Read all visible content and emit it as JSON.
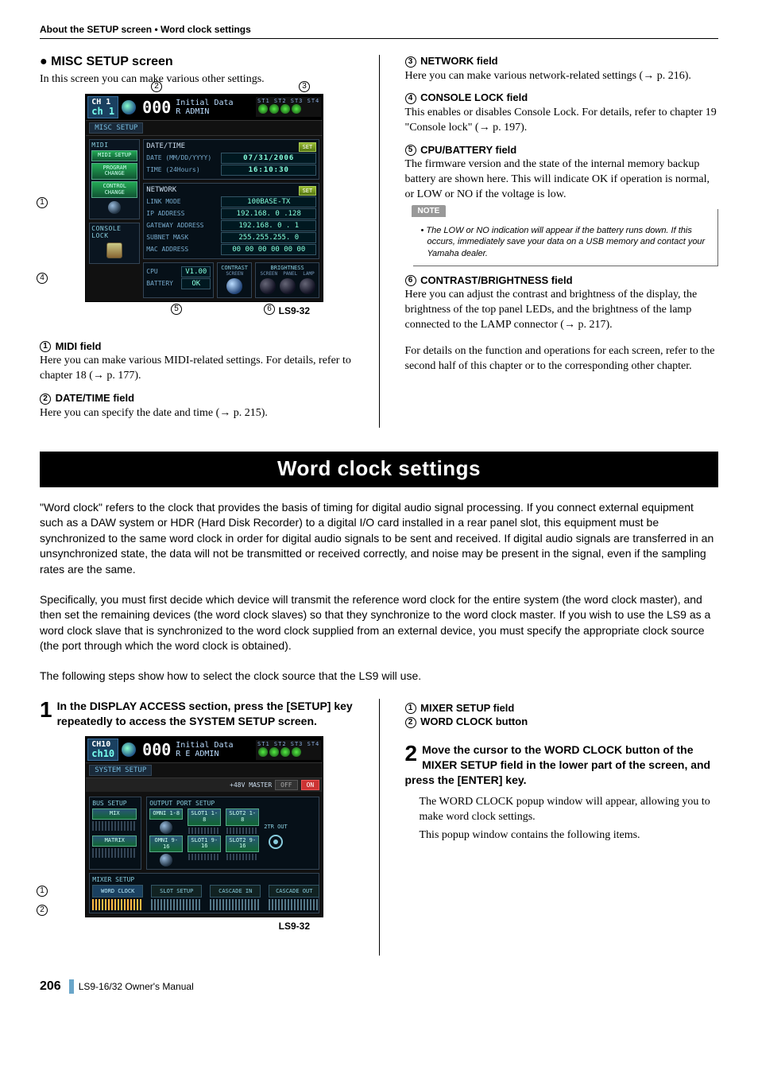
{
  "header": "About the SETUP screen • Word clock settings",
  "left": {
    "miscHeading": "MISC SETUP screen",
    "miscIntro": "In this screen you can make various other settings.",
    "fig1Caption": "LS9-32",
    "field1Title": "MIDI field",
    "field1Body": "Here you can make various MIDI-related settings. For details, refer to chapter 18 (→ p. 177).",
    "field2Title": "DATE/TIME field",
    "field2Body": "Here you can specify the date and time (→ p. 215)."
  },
  "right": {
    "field3Title": "NETWORK field",
    "field3Body": "Here you can make various network-related settings (→ p. 216).",
    "field4Title": "CONSOLE LOCK field",
    "field4Body": "This enables or disables Console Lock. For details, refer to chapter 19 \"Console lock\" (→ p. 197).",
    "field5Title": "CPU/BATTERY field",
    "field5Body": "The firmware version and the state of the internal memory backup battery are shown here. This will indicate OK if operation is normal, or LOW or NO if the voltage is low.",
    "noteLabel": "NOTE",
    "noteText": "• The LOW or NO indication will appear if the battery runs down. If this occurs, immediately save your data on a USB memory and contact your Yamaha dealer.",
    "field6Title": "CONTRAST/BRIGHTNESS field",
    "field6Body": "Here you can adjust the contrast and brightness of the display, the brightness of the top panel LEDs, and the brightness of the lamp connected to the LAMP connector (→ p. 217).",
    "closing": "For details on the function and operations for each screen, refer to the second half of this chapter or to the corresponding other chapter."
  },
  "section": {
    "banner": "Word clock settings",
    "introP1": "\"Word clock\" refers to the clock that provides the basis of timing for digital audio signal processing. If you connect external equipment such as a DAW system or HDR (Hard Disk Recorder) to a digital I/O card installed in a rear panel slot, this equipment must be synchronized to the same word clock in order for digital audio signals to be sent and received. If digital audio signals are transferred in an unsynchronized state, the data will not be transmitted or received correctly, and noise may be present in the signal, even if the sampling rates are the same.",
    "introP2": "Specifically, you must first decide which device will transmit the reference word clock for the entire system (the word clock master), and then set the remaining devices (the word clock slaves) so that they synchronize to the word clock master. If you wish to use the LS9 as a word clock slave that is synchronized to the word clock supplied from an external device, you must specify the appropriate clock source (the port through which the word clock is obtained).",
    "introP3": "The following steps show how to select the clock source that the LS9 will use."
  },
  "steps": {
    "s1num": "1",
    "s1head": "In the DISPLAY ACCESS section, press the [SETUP] key repeatedly to access the SYSTEM SETUP screen.",
    "fig2Caption": "LS9-32",
    "callLabel1": "MIXER SETUP field",
    "callLabel2": "WORD CLOCK button",
    "s2num": "2",
    "s2head": "Move the cursor to the WORD CLOCK button of the MIXER SETUP field in the lower part of the screen, and press the [ENTER] key.",
    "s2body1": "The WORD CLOCK popup window will appear, allowing you to make word clock settings.",
    "s2body2": "This popup window contains the following items."
  },
  "misc_screen": {
    "ch_label": "CH 1",
    "ch_name": "ch 1",
    "scene_num": "000",
    "scene_name_top": "Initial Data",
    "scene_name_bot": "R       ADMIN",
    "st_header": "ST1 ST2 ST3 ST4",
    "tab": "MISC SETUP",
    "midi_title": "MIDI",
    "midi_btn": "MIDI SETUP",
    "prog_btn": "PROGRAM CHANGE",
    "ctrl_btn": "CONTROL CHANGE",
    "dt_title": "DATE/TIME",
    "date_lbl": "DATE (MM/DD/YYYY)",
    "date_val": "07/31/2006",
    "time_lbl": "TIME (24Hours)",
    "time_val": "16:10:30",
    "set": "SET",
    "net_title": "NETWORK",
    "link_lbl": "LINK MODE",
    "link_val": "100BASE-TX",
    "ip_lbl": "IP ADDRESS",
    "ip_val": "192.168. 0 .128",
    "gw_lbl": "GATEWAY ADDRESS",
    "gw_val": "192.168. 0 . 1",
    "sm_lbl": "SUBNET MASK",
    "sm_val": "255.255.255. 0",
    "mac_lbl": "MAC ADDRESS",
    "mac_val": "00 00 00 00 00 00",
    "cl_title": "CONSOLE LOCK",
    "cpu_lbl": "CPU",
    "cpu_val": "V1.00",
    "bat_lbl": "BATTERY",
    "bat_val": "OK",
    "contrast": "CONTRAST",
    "screen": "SCREEN",
    "brightness": "BRIGHTNESS",
    "panel": "PANEL",
    "lamp": "LAMP"
  },
  "sys_screen": {
    "ch_label": "CH10",
    "ch_name": "ch10",
    "scene_num": "000",
    "scene_name_top": "Initial Data",
    "scene_name_bot": "R E     ADMIN",
    "st_header": "ST1 ST2 ST3 ST4",
    "tab": "SYSTEM SETUP",
    "master_lbl": "+48V MASTER",
    "off": "OFF",
    "on": "ON",
    "bus_title": "BUS SETUP",
    "mix": "MIX",
    "matrix": "MATRIX",
    "out_title": "OUTPUT PORT SETUP",
    "omni18": "OMNI 1-8",
    "omni916": "OMNI 9-16",
    "slot1_18": "SLOT1 1-8",
    "slot2_18": "SLOT2 1-8",
    "slot1_916": "SLOT1 9-16",
    "slot2_916": "SLOT2 9-16",
    "tr_out": "2TR OUT",
    "ms_title": "MIXER SETUP",
    "wordclock": "WORD CLOCK",
    "slotsetup": "SLOT SETUP",
    "cascin": "CASCADE IN",
    "cascout": "CASCADE OUT"
  },
  "footer": {
    "page": "206",
    "doc": "LS9-16/32  Owner's Manual"
  }
}
